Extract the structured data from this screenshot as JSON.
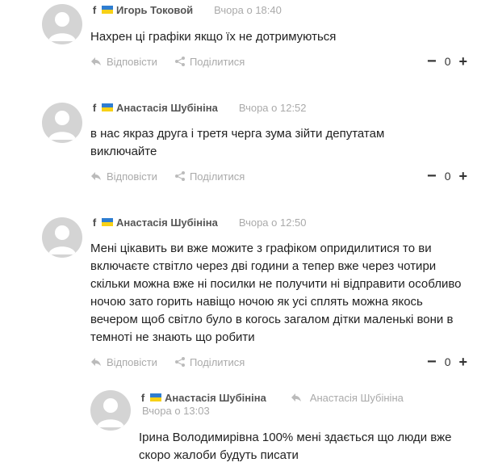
{
  "comments": [
    {
      "fb": "f",
      "author": "Игорь Токовой",
      "time": "Вчора о 18:40",
      "text": "Нахрен  ці графіки якщо їх не дотримуються",
      "reply_label": "Відповісти",
      "share_label": "Поділитися",
      "minus": "−",
      "score": "0",
      "plus": "+"
    },
    {
      "fb": "f",
      "author": "Анастасія Шубініна",
      "time": "Вчора о 12:52",
      "text": "в нас якраз друга і третя черга зума зійти депутатам виключайте",
      "reply_label": "Відповісти",
      "share_label": "Поділитися",
      "minus": "−",
      "score": "0",
      "plus": "+"
    },
    {
      "fb": "f",
      "author": "Анастасія Шубініна",
      "time": "Вчора о 12:50",
      "text": "Мені цікавить ви вже можите з графіком опридилитися то ви включаєте ствітло через дві години а тепер вже через чотири скільки можна вже ні посилки не получити ні відправити особливо ночою зато горить навіщо ночою як усі сплять можна якось вечером щоб світло було в когось загалом дітки маленькі вони в темноті не знають що робити",
      "reply_label": "Відповісти",
      "share_label": "Поділитися",
      "minus": "−",
      "score": "0",
      "plus": "+"
    }
  ],
  "reply": {
    "fb": "f",
    "author": "Анастасія Шубініна",
    "reply_to": "Анастасія Шубініна",
    "time": "Вчора о 13:03",
    "text": "Ірина Володимирівна 100% мені здається що люди вже скоро жалоби будуть писати"
  },
  "icons": {
    "reply": "reply-arrow-icon",
    "share": "share-icon",
    "avatar": "default-user-avatar-icon",
    "flag": "ukraine-flag-icon",
    "facebook": "facebook-icon"
  },
  "colors": {
    "muted": "#aaaaaa",
    "text": "#222222",
    "avatar_bg": "#d4d4d4",
    "flag_blue": "#2e7dd1",
    "flag_yellow": "#f7d117"
  }
}
